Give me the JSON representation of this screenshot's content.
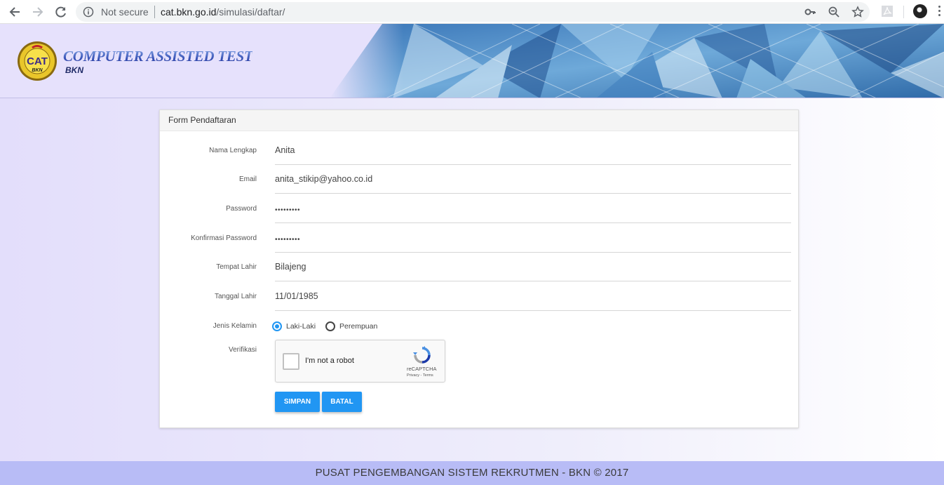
{
  "browser": {
    "security_label": "Not secure",
    "url_host": "cat.bkn.go.id",
    "url_path": "/simulasi/daftar/"
  },
  "header": {
    "title": "COMPUTER ASSISTED TEST",
    "subtitle": "BKN",
    "logo_text": "CAT",
    "logo_subtext": "BKN"
  },
  "form": {
    "title": "Form Pendaftaran",
    "fields": [
      {
        "label": "Nama Lengkap",
        "value": "Anita"
      },
      {
        "label": "Email",
        "value": "anita_stikip@yahoo.co.id"
      },
      {
        "label": "Password",
        "value": "•••••••••"
      },
      {
        "label": "Konfirmasi Password",
        "value": "•••••••••"
      },
      {
        "label": "Tempat Lahir",
        "value": "Bilajeng"
      },
      {
        "label": "Tanggal Lahir",
        "value": "11/01/1985"
      }
    ],
    "gender": {
      "label": "Jenis Kelamin",
      "options": [
        "Laki-Laki",
        "Perempuan"
      ],
      "selected": "Laki-Laki"
    },
    "verification": {
      "label": "Verifikasi",
      "captcha_text": "I'm not a robot",
      "captcha_brand": "reCAPTCHA",
      "captcha_terms": "Privacy - Terms"
    },
    "buttons": {
      "save": "SIMPAN",
      "cancel": "BATAL"
    }
  },
  "footer": {
    "text": "PUSAT PENGEMBANGAN SISTEM REKRUTMEN - BKN © 2017"
  },
  "colors": {
    "accent": "#2196f3",
    "header_bg": "#e6e1fc",
    "footer_bg": "#b8bcf6"
  }
}
